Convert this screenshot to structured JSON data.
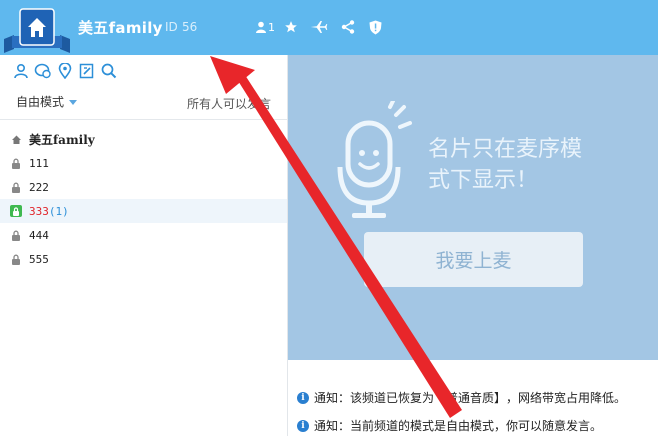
{
  "header": {
    "room_name": "美五family",
    "id_label": "ID",
    "id_value": "56",
    "user_count": "1",
    "icons": [
      "home-logo-icon",
      "user-icon",
      "star-icon",
      "plane-icon",
      "share-icon",
      "shield-icon"
    ]
  },
  "sidebar": {
    "tools": [
      "user-tree-icon",
      "chat-bubble-icon",
      "location-pin-icon",
      "edit-board-icon",
      "search-icon"
    ],
    "mode": "自由模式",
    "mode_note": "所有人可以发言",
    "channels": [
      {
        "name": "美五family",
        "icon": "home-icon"
      },
      {
        "name": "111",
        "icon": "lock-icon"
      },
      {
        "name": "222",
        "icon": "lock-icon"
      },
      {
        "name": "333",
        "count": "(1)",
        "icon": "lock-open-green-icon"
      },
      {
        "name": "444",
        "icon": "lock-icon"
      },
      {
        "name": "555",
        "icon": "lock-icon"
      }
    ]
  },
  "main": {
    "card_message_line1": "名片只在麦序模",
    "card_message_line2": "式下显示！",
    "mic_button": "我要上麦"
  },
  "notices": {
    "n1_prefix": "通知：该频道已恢复为",
    "n1_highlight": "【普通音质】",
    "n1_suffix": "，网络带宽占用降低。",
    "n2_prefix": "通知：当前频道的模式是",
    "n2_highlight": "自由模式",
    "n2_suffix": "，你可以随意发言。"
  },
  "colors": {
    "topbar": "#5fb8ee",
    "right_panel": "#a3c6e4",
    "arrow": "#e8262a",
    "selected_row": "#eef5fb"
  }
}
